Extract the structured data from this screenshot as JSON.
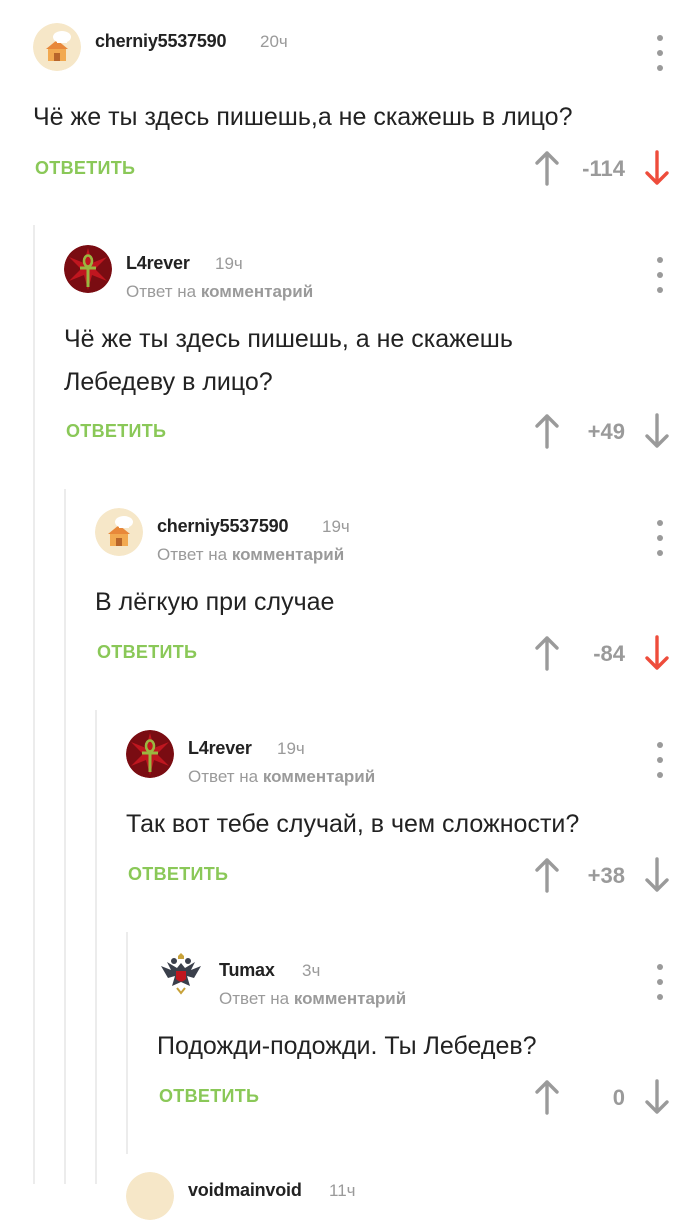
{
  "comments": [
    {
      "author": "cherniy5537590",
      "time": "20ч",
      "reply_prefix": "",
      "reply_target": "",
      "text_lines": [
        "Чё же ты здесь пишешь,а не скажешь в лицо?"
      ],
      "reply_label": "ОТВЕТИТЬ",
      "score": "-114",
      "vote": "down",
      "avatar": "chef-hat-house-icon"
    },
    {
      "author": "L4rever",
      "time": "19ч",
      "reply_prefix": "Ответ на",
      "reply_target": "комментарий",
      "text_lines": [
        "Чё же ты здесь пишешь, а не скажешь",
        "Лебедеву в лицо?"
      ],
      "reply_label": "ОТВЕТИТЬ",
      "score": "+49",
      "vote": "none",
      "avatar": "red-ankh-icon"
    },
    {
      "author": "cherniy5537590",
      "time": "19ч",
      "reply_prefix": "Ответ на",
      "reply_target": "комментарий",
      "text_lines": [
        "В лёгкую при случае"
      ],
      "reply_label": "ОТВЕТИТЬ",
      "score": "-84",
      "vote": "down",
      "avatar": "chef-hat-house-icon"
    },
    {
      "author": "L4rever",
      "time": "19ч",
      "reply_prefix": "Ответ на",
      "reply_target": "комментарий",
      "text_lines": [
        "Так вот тебе случай, в чем сложности?"
      ],
      "reply_label": "ОТВЕТИТЬ",
      "score": "+38",
      "vote": "none",
      "avatar": "red-ankh-icon"
    },
    {
      "author": "Tumax",
      "time": "3ч",
      "reply_prefix": "Ответ на",
      "reply_target": "комментарий",
      "text_lines": [
        "Подожди-подожди. Ты Лебедев?"
      ],
      "reply_label": "ОТВЕТИТЬ",
      "score": "0",
      "vote": "none",
      "avatar": "double-headed-eagle-icon"
    }
  ],
  "partial_comment": {
    "author": "voidmainvoid",
    "time": "11ч"
  },
  "colors": {
    "accent_green": "#8ac858",
    "downvote_red": "#ee4c3b",
    "muted_gray": "#9a9a9a",
    "text": "#222222"
  }
}
